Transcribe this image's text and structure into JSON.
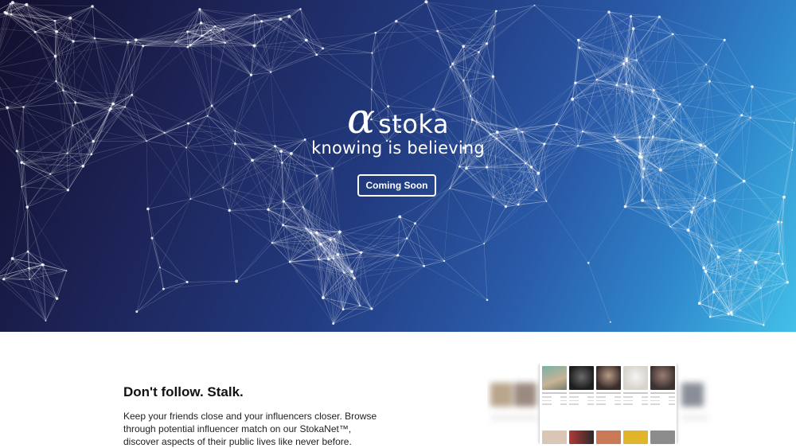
{
  "hero": {
    "logo_symbol": "α",
    "logo_text": "stoka",
    "tagline": "knowing is believing",
    "cta_label": "Coming Soon",
    "background_colors": [
      "#120f2e",
      "#223b80",
      "#43c0e8"
    ],
    "network_color": "#ffffff"
  },
  "section": {
    "heading": "Don't follow. Stalk.",
    "body": "Keep your friends close and your influencers closer. Browse through potential influencer match on our StokaNet™, discover aspects of their public lives like never before."
  },
  "preview": {
    "description_icon": "profile-grid-screenshot"
  }
}
